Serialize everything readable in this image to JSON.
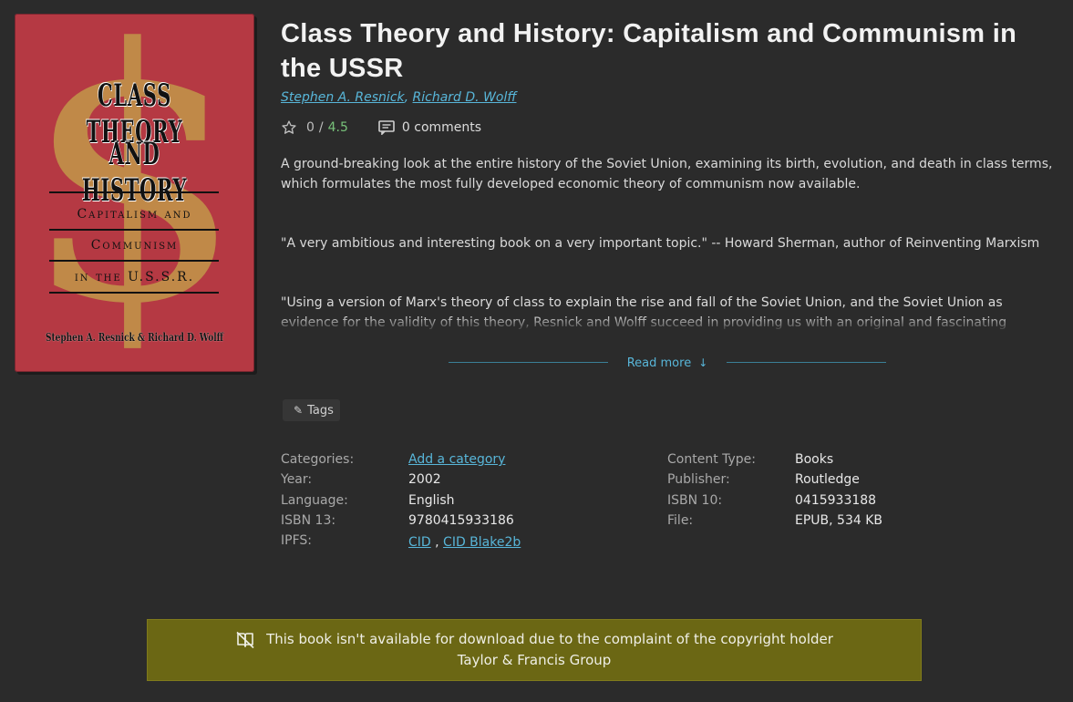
{
  "cover": {
    "title_line1": "CLASS THEORY",
    "title_line2": "AND HISTORY",
    "sub1": "Capitalism and",
    "sub2": "Communism",
    "sub3": "in the U.S.S.R.",
    "authors": "Stephen A. Resnick & Richard D. Wolff",
    "accent": "#b53943"
  },
  "book": {
    "title": "Class Theory and History: Capitalism and Communism in the USSR",
    "authors": [
      "Stephen A. Resnick",
      "Richard D. Wolff"
    ],
    "rating_user": "0",
    "rating_sep": "/",
    "rating_avg": "4.5",
    "comments": "0 comments"
  },
  "description": {
    "p1": "A ground-breaking look at the entire history of the Soviet Union, examining its birth, evolution, and death in class terms, which formulates the most fully developed economic theory of communism now available.",
    "p2": "\"A very ambitious and interesting book on a very important topic.\" -- Howard Sherman, author of Reinventing Marxism",
    "p3": "\"Using a version of Marx's theory of class to explain the rise and fall of the Soviet Union, and the Soviet Union as evidence for the validity of this theory, Resnick and Wolff succeed in providing us with an original and fascinating account of both.",
    "read_more": "Read more"
  },
  "tags": {
    "label": "Tags"
  },
  "properties": {
    "categories_label": "Categories:",
    "categories_value": "Add a category",
    "year_label": "Year:",
    "year_value": "2002",
    "language_label": "Language:",
    "language_value": "English",
    "isbn13_label": "ISBN 13:",
    "isbn13_value": "9780415933186",
    "ipfs_label": "IPFS:",
    "ipfs_cid": "CID",
    "ipfs_sep": ",",
    "ipfs_blake": "CID Blake2b",
    "content_type_label": "Content Type:",
    "content_type_value": "Books",
    "publisher_label": "Publisher:",
    "publisher_value": "Routledge",
    "isbn10_label": "ISBN 10:",
    "isbn10_value": "0415933188",
    "file_label": "File:",
    "file_value": "EPUB, 534 KB"
  },
  "notice": {
    "line1": "This book isn't available for download due to the complaint of the copyright holder",
    "line2": "Taylor & Francis Group",
    "background": "#6b6714"
  }
}
